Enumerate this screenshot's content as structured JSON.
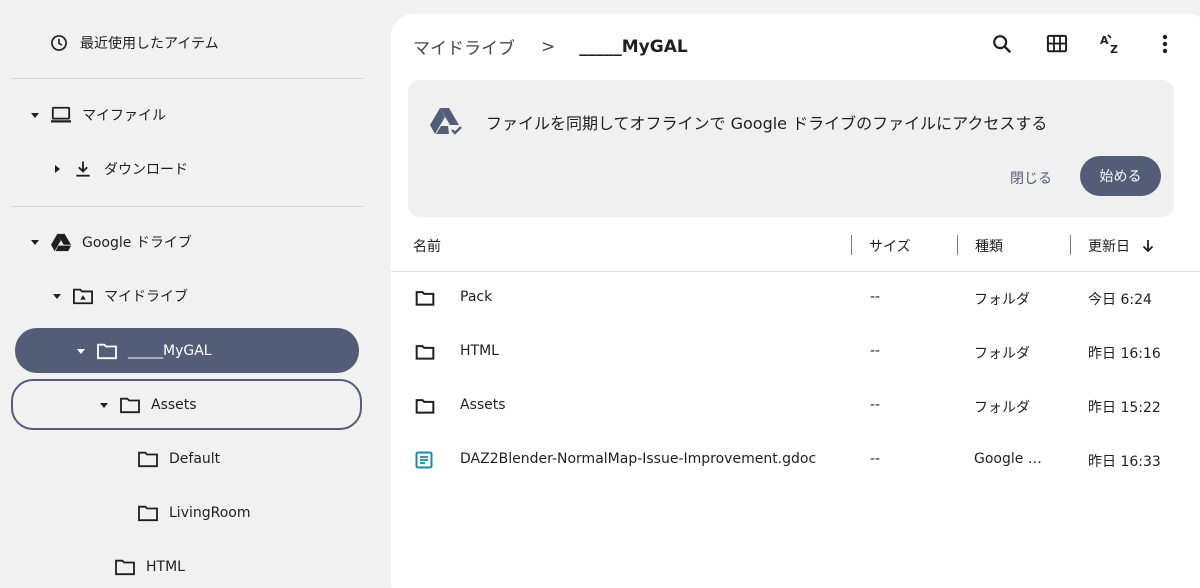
{
  "sidebar": {
    "recent": "最近使用したアイテム",
    "my_files": "マイファイル",
    "downloads": "ダウンロード",
    "google_drive": "Google ドライブ",
    "my_drive": "マイドライブ",
    "mygal": "_____MyGAL",
    "assets": "Assets",
    "default": "Default",
    "living_room": "LivingRoom",
    "html": "HTML"
  },
  "header": {
    "breadcrumb_root": "マイドライブ",
    "breadcrumb_sep": ">",
    "breadcrumb_current": "_____MyGAL",
    "icons": [
      "search-icon",
      "grid-view-icon",
      "sort-az-icon",
      "more-vert-icon"
    ]
  },
  "banner": {
    "text": "ファイルを同期してオフラインで Google ドライブのファイルにアクセスする",
    "close_label": "閉じる",
    "start_label": "始める"
  },
  "table": {
    "headers": {
      "name": "名前",
      "size": "サイズ",
      "type": "種類",
      "modified": "更新日"
    },
    "rows": [
      {
        "icon": "folder-icon",
        "name": "Pack",
        "size": "--",
        "type": "フォルダ",
        "modified": "今日 6:24"
      },
      {
        "icon": "folder-icon",
        "name": "HTML",
        "size": "--",
        "type": "フォルダ",
        "modified": "昨日 16:16"
      },
      {
        "icon": "folder-icon",
        "name": "Assets",
        "size": "--",
        "type": "フォルダ",
        "modified": "昨日 15:22"
      },
      {
        "icon": "google-doc-icon",
        "name": "DAZ2Blender-NormalMap-Issue-Improvement.gdoc",
        "size": "--",
        "type": "Google …",
        "modified": "昨日 16:33"
      }
    ]
  },
  "colors": {
    "accent": "#535d78",
    "sidebar_bg": "#f1f1f1",
    "panel_bg": "#ffffff",
    "doc_icon": "#1a8aa0"
  }
}
